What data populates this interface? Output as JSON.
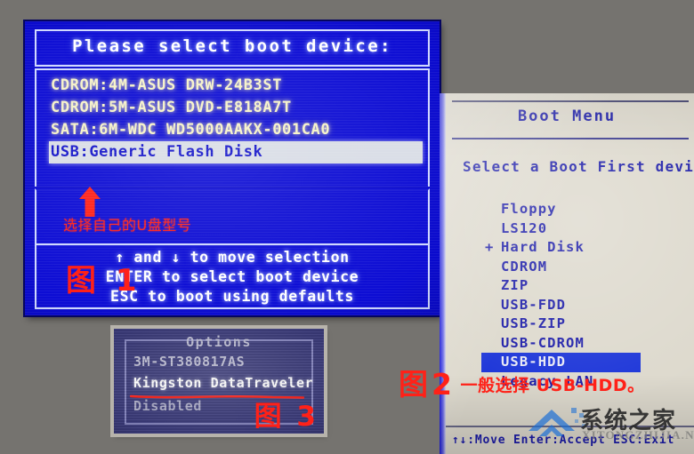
{
  "figure1": {
    "title": "Please select boot device:",
    "devices": [
      {
        "label": "CDROM:4M-ASUS  DRW-24B3ST",
        "selected": false
      },
      {
        "label": "CDROM:5M-ASUS  DVD-E818A7T",
        "selected": false
      },
      {
        "label": "SATA:6M-WDC  WD5000AAKX-001CA0",
        "selected": false
      },
      {
        "label": "USB:Generic  Flash Disk",
        "selected": true
      }
    ],
    "annotation_cn": "选择自己的U盘型号",
    "arrow_icon": "up-arrow-icon",
    "help_lines": [
      "↑ and ↓ to move selection",
      "ENTER to select boot device",
      "ESC to boot using defaults"
    ],
    "figure_label": "图 1"
  },
  "figure2": {
    "title": "Boot Menu",
    "subtitle": "Select a Boot First device",
    "items": [
      {
        "label": "Floppy",
        "marker": "",
        "selected": false
      },
      {
        "label": "LS120",
        "marker": "",
        "selected": false
      },
      {
        "label": "Hard Disk",
        "marker": "+",
        "selected": false
      },
      {
        "label": "CDROM",
        "marker": "",
        "selected": false
      },
      {
        "label": "ZIP",
        "marker": "",
        "selected": false
      },
      {
        "label": "USB-FDD",
        "marker": "",
        "selected": false
      },
      {
        "label": "USB-ZIP",
        "marker": "",
        "selected": false
      },
      {
        "label": "USB-CDROM",
        "marker": "",
        "selected": false
      },
      {
        "label": "USB-HDD",
        "marker": "",
        "selected": true
      },
      {
        "label": "Legacy LAN",
        "marker": "",
        "selected": false
      }
    ],
    "bottom_bar": "↑↓:Move  Enter:Accept  ESC:Exit",
    "figure_label": "图",
    "figure_number": "2",
    "annotation_cn": "一般选择 USB-HDD。"
  },
  "figure3": {
    "title": "Options",
    "rows": [
      {
        "label": "3M-ST380817AS",
        "highlighted": false
      },
      {
        "label": "Kingston DataTraveler",
        "highlighted": true
      },
      {
        "label": "Disabled",
        "highlighted": false
      }
    ],
    "underline_icon": "red-underline-marker",
    "figure_label": "图 3"
  },
  "watermark": {
    "text_cn": "系统之家",
    "text_en": "XITONGZHIJIA.NET",
    "logo_icon": "house-logo-icon"
  },
  "colors": {
    "page_background": "#75736f",
    "bios_blue": "#0a0acd",
    "bios_yellow_text": "#f6f2c8",
    "selection_white": "#d9dde6",
    "annotation_red": "#ff2118",
    "boot_menu_beige": "#ddd9cd",
    "boot_menu_blue_text": "#1b1ba8",
    "boot_menu_highlight": "#1b34d8"
  }
}
